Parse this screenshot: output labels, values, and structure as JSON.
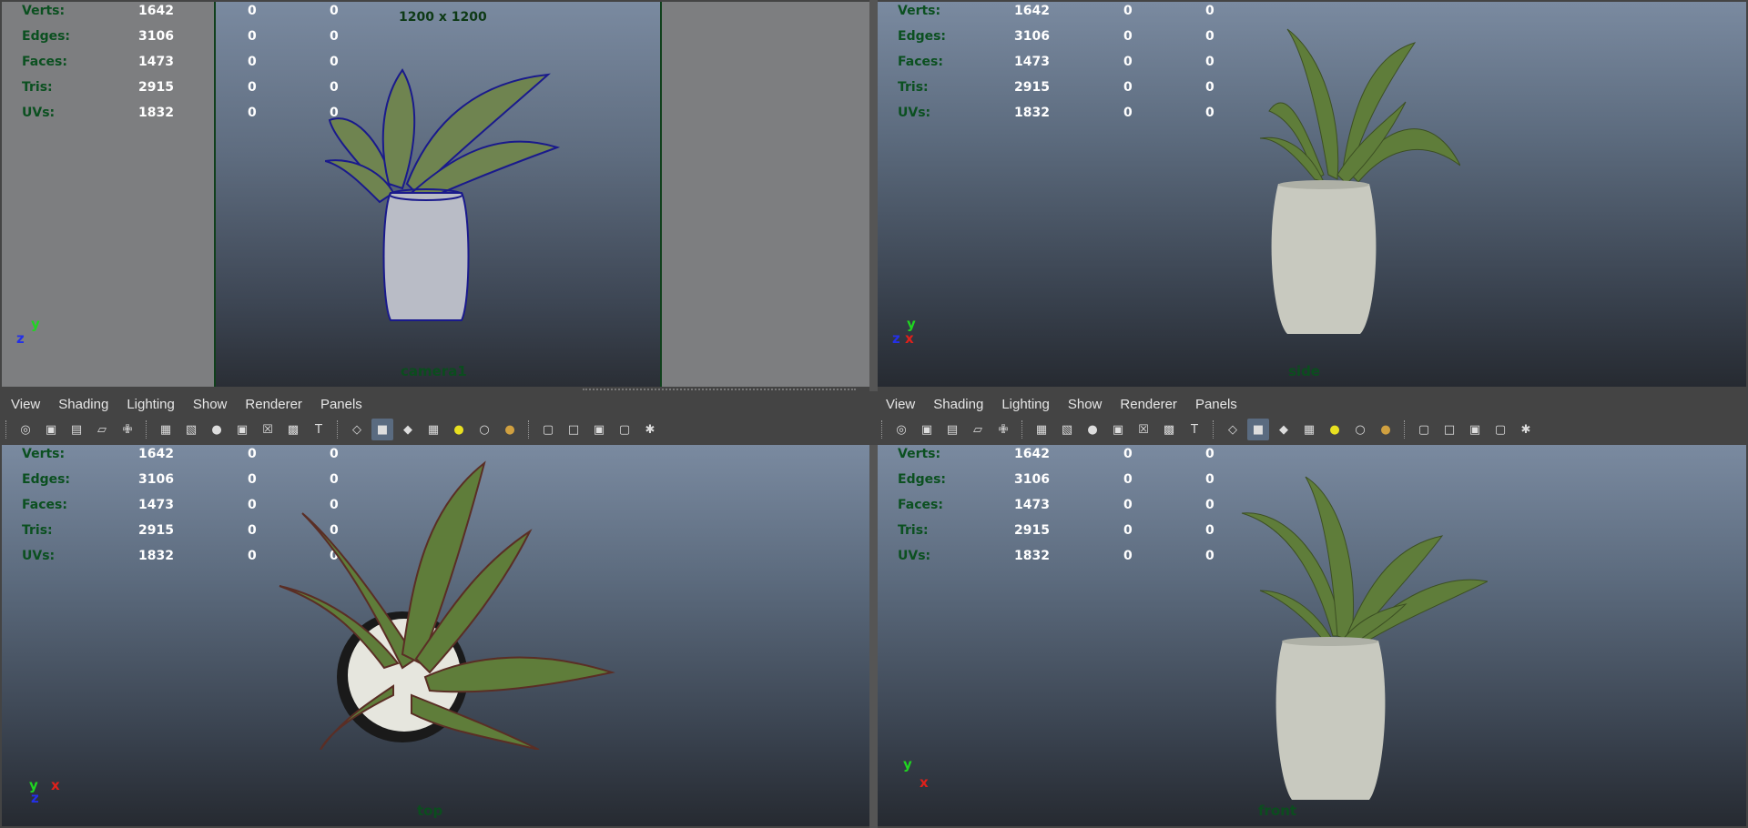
{
  "hud_stats": [
    {
      "label": "Verts:",
      "v1": "1642",
      "v2": "0",
      "v3": "0"
    },
    {
      "label": "Edges:",
      "v1": "3106",
      "v2": "0",
      "v3": "0"
    },
    {
      "label": "Faces:",
      "v1": "1473",
      "v2": "0",
      "v3": "0"
    },
    {
      "label": "Tris:",
      "v1": "2915",
      "v2": "0",
      "v3": "0"
    },
    {
      "label": "UVs:",
      "v1": "1832",
      "v2": "0",
      "v3": "0"
    }
  ],
  "viewports": {
    "persp": {
      "camera": "camera1",
      "resolution": "1200 x 1200"
    },
    "side": {
      "camera": "side"
    },
    "top": {
      "camera": "top"
    },
    "front": {
      "camera": "front"
    }
  },
  "menu": {
    "items": [
      "View",
      "Shading",
      "Lighting",
      "Show",
      "Renderer",
      "Panels"
    ]
  },
  "toolbar_icons": [
    "camera-select-icon",
    "camera-attributes-icon",
    "bookmark-icon",
    "image-plane-icon",
    "2d-pan-zoom-icon",
    "grid-icon",
    "film-gate-icon",
    "resolution-gate-icon",
    "gate-mask-icon",
    "field-chart-icon",
    "safe-action-icon",
    "safe-title-icon",
    "wireframe-icon",
    "smooth-shade-icon",
    "wireframe-on-shaded-icon",
    "textured-icon",
    "use-all-lights-icon",
    "shadows-icon",
    "ambient-occlusion-icon",
    "isolate-select-icon",
    "xray-icon",
    "xray-joints-icon",
    "backface-icon",
    "share-icon"
  ],
  "axis_labels": {
    "x": "x",
    "y": "y",
    "z": "z"
  },
  "colors": {
    "hud_label": "#0b5020",
    "hud_value": "#ffffff",
    "wireframe": "#1a1a8c",
    "leaf": "#5f7d3a",
    "pot": "#c8c9bf"
  }
}
